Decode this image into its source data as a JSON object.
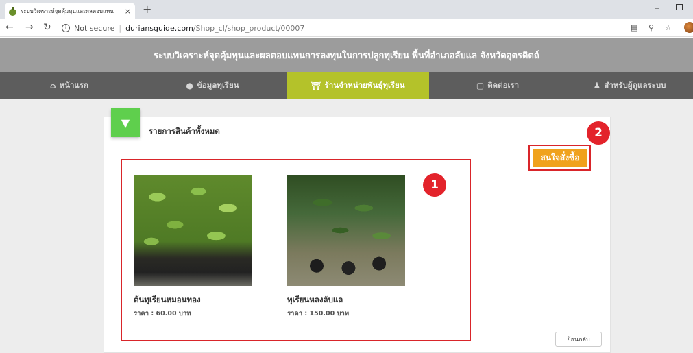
{
  "browser": {
    "tab_title": "ระบบวิเคราะห์จุดคุ้มทุนและผลตอบแทน",
    "tab_close": "×",
    "new_tab": "+",
    "security_label": "Not secure",
    "url_host": "duriansguide.com",
    "url_path": "/Shop_cl/shop_product/00007"
  },
  "site": {
    "title": "ระบบวิเคราะห์จุดคุ้มทุนและผลตอบแทนการลงทุนในการปลูกทุเรียน พื้นที่อำเภอลับแล จังหวัดอุตรดิตถ์"
  },
  "nav": {
    "items": [
      {
        "label": "หน้าแรก",
        "icon": "home-icon"
      },
      {
        "label": "ข้อมูลทุเรียน",
        "icon": "durian-icon"
      },
      {
        "label": "ร้านจำหน่ายพันธุ์ทุเรียน",
        "icon": "shop-icon"
      },
      {
        "label": "ติดต่อเรา",
        "icon": "chat-icon"
      },
      {
        "label": "สำหรับผู้ดูแลระบบ",
        "icon": "admin-icon"
      }
    ]
  },
  "main": {
    "section_title": "รายการสินค้าทั้งหมด",
    "order_button": "สนใจสั่งซื้อ",
    "back_button": "ย้อนกลับ",
    "badge_1": "1",
    "badge_2": "2",
    "products": [
      {
        "name": "ต้นทุเรียนหมอนทอง",
        "price": "ราคา : 60.00 บาท"
      },
      {
        "name": "ทุเรียนหลงลับแล",
        "price": "ราคา : 150.00 บาท"
      }
    ]
  },
  "colors": {
    "header_bg": "#9c9c9c",
    "navbar_bg": "#5d5d5d",
    "nav_active": "#b4c22a",
    "order_button": "#f0a21d",
    "highlight": "#d9252a",
    "card_icon": "#5fcf4d"
  }
}
